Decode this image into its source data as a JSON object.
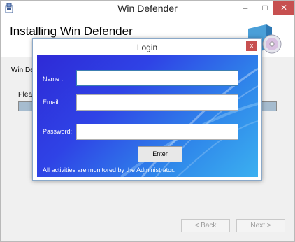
{
  "window": {
    "title": "Win Defender",
    "header_title": "Installing Win Defender",
    "body_text_partial": "Win De",
    "please_text_partial": "Pleas",
    "back_label": "< Back",
    "next_label": "Next >",
    "controls": {
      "minimize": "–",
      "maximize": "□",
      "close": "✕"
    }
  },
  "login": {
    "title": "Login",
    "close_label": "x",
    "name_label": "Name :",
    "email_label": "Email:",
    "password_label": "Password:",
    "name_value": "",
    "email_value": "",
    "password_value": "",
    "enter_label": "Enter",
    "notice": "All activities are monitored by the Administrator."
  },
  "colors": {
    "panel_start": "#2e2ad6",
    "panel_end": "#3bb0f0",
    "close_red": "#c75050",
    "progress_fill": "#a6bccf"
  },
  "icons": {
    "app": "installer-icon",
    "header": "disc-box-icon"
  }
}
